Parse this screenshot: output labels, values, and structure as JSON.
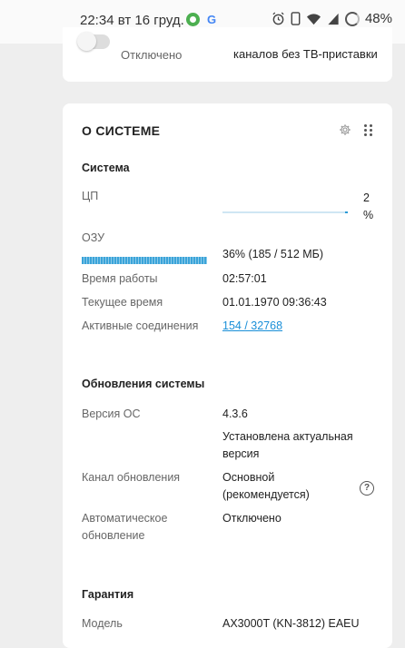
{
  "status_bar": {
    "time_date": "22:34 вт 16 груд.",
    "battery": "48%",
    "icons": [
      "app-icon",
      "google-icon",
      "alarm-icon",
      "phone-icon",
      "wifi-icon",
      "signal-icon",
      "battery-icon"
    ]
  },
  "top_card": {
    "toggle_status": "Отключено",
    "description": "каналов без ТВ-приставки",
    "toggle_on": false
  },
  "system_card": {
    "title": "О СИСТЕМЕ",
    "icons": [
      "gear-icon",
      "drag-handle-icon"
    ],
    "system_section": {
      "heading": "Система",
      "cpu_label": "ЦП",
      "cpu_value_num": "2",
      "cpu_value_unit": "%",
      "cpu_load": 2,
      "ram_label": "ОЗУ",
      "ram_value": "36% (185 / 512 МБ)",
      "ram_fraction": 0.36,
      "uptime_label": "Время работы",
      "uptime_value": "02:57:01",
      "current_time_label": "Текущее время",
      "current_time_value": "01.01.1970 09:36:43",
      "connections_label": "Активные соединения",
      "connections_value": "154 / 32768"
    },
    "updates_section": {
      "heading": "Обновления системы",
      "os_version_label": "Версия ОС",
      "os_version_value": "4.3.6",
      "os_status_line1": "Установлена актуальная",
      "os_status_line2": "версия",
      "channel_label": "Канал обновления",
      "channel_value_line1": "Основной",
      "channel_value_line2": "(рекомендуется)",
      "auto_label_line1": "Автоматическое",
      "auto_label_line2": "обновление",
      "auto_value": "Отключено"
    },
    "warranty_section": {
      "heading": "Гарантия",
      "model_label": "Модель",
      "model_value": "AX3000T (KN-3812) EAEU"
    }
  },
  "colors": {
    "background": "#eeeeee",
    "card": "#ffffff",
    "accent_link": "#1a8fd8",
    "bar_fill": "#3aa3d9"
  }
}
